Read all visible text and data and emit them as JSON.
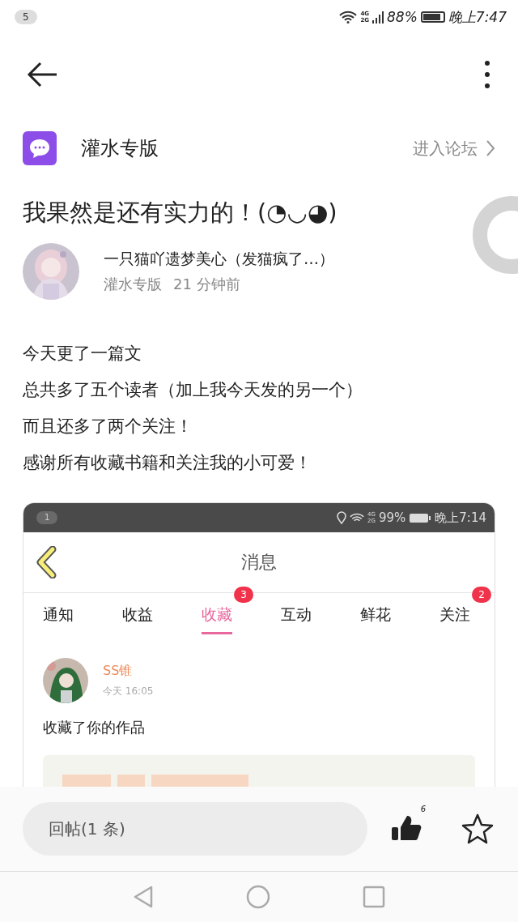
{
  "status_bar": {
    "notification": "5",
    "network": [
      "4G",
      "2G"
    ],
    "battery": "88%",
    "time": "晚上7:47"
  },
  "forum": {
    "name": "灌水专版",
    "enter_link": "进入论坛"
  },
  "post": {
    "title": "我果然是还有实力的！(◔◡◕)",
    "author": "一只猫吖遗梦美心（发猫疯了…）",
    "board": "灌水专版",
    "time": "21 分钟前",
    "body": [
      "今天更了一篇文",
      "总共多了五个读者（加上我今天发的另一个）",
      "而且还多了两个关注！",
      "感谢所有收藏书籍和关注我的小可爱！"
    ]
  },
  "screenshot": {
    "status_bar": {
      "notification": "1",
      "network": [
        "4G",
        "2G"
      ],
      "battery": "99%",
      "time": "晚上7:14"
    },
    "title": "消息",
    "tabs": [
      {
        "label": "通知",
        "selected": false
      },
      {
        "label": "收益",
        "selected": false
      },
      {
        "label": "收藏",
        "selected": true,
        "badge": "3"
      },
      {
        "label": "互动",
        "selected": false
      },
      {
        "label": "鲜花",
        "selected": false
      },
      {
        "label": "关注",
        "selected": false,
        "badge": "2"
      }
    ],
    "message": {
      "user": "SS锥",
      "time": "今天 16:05",
      "text": "收藏了你的作品"
    }
  },
  "reply_bar": {
    "placeholder": "回帖(1 条)",
    "like_count": "6"
  }
}
